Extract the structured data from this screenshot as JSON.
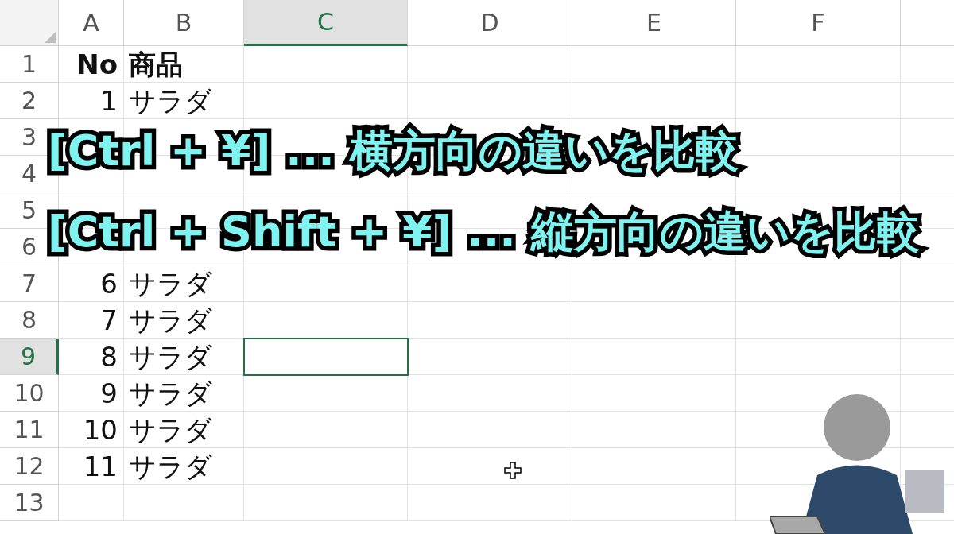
{
  "columns": [
    {
      "label": "A",
      "selected": false
    },
    {
      "label": "B",
      "selected": false
    },
    {
      "label": "C",
      "selected": true
    },
    {
      "label": "D",
      "selected": false
    },
    {
      "label": "E",
      "selected": false
    },
    {
      "label": "F",
      "selected": false
    }
  ],
  "rows": [
    {
      "label": "1",
      "selected": false,
      "kind": "header",
      "cells": [
        "No",
        "商品"
      ]
    },
    {
      "label": "2",
      "selected": false,
      "kind": "data",
      "cells": [
        "1",
        "サラダ"
      ]
    },
    {
      "label": "3",
      "selected": false,
      "kind": "data"
    },
    {
      "label": "4",
      "selected": false,
      "kind": "data"
    },
    {
      "label": "5",
      "selected": false,
      "kind": "data"
    },
    {
      "label": "6",
      "selected": false,
      "kind": "data"
    },
    {
      "label": "7",
      "selected": false,
      "kind": "data",
      "cells": [
        "6",
        "サラダ"
      ]
    },
    {
      "label": "8",
      "selected": false,
      "kind": "data",
      "cells": [
        "7",
        "サラダ"
      ]
    },
    {
      "label": "9",
      "selected": true,
      "kind": "data",
      "cells": [
        "8",
        "サラダ"
      ]
    },
    {
      "label": "10",
      "selected": false,
      "kind": "data",
      "cells": [
        "9",
        "サラダ"
      ]
    },
    {
      "label": "11",
      "selected": false,
      "kind": "data",
      "cells": [
        "10",
        "サラダ"
      ]
    },
    {
      "label": "12",
      "selected": false,
      "kind": "data",
      "cells": [
        "11",
        "サラダ"
      ]
    },
    {
      "label": "13",
      "selected": false,
      "kind": "data"
    }
  ],
  "captions": [
    "[Ctrl + ¥] ... 横方向の違いを比較",
    "[Ctrl + Shift + ¥] ... 縦方向の違いを比較"
  ]
}
